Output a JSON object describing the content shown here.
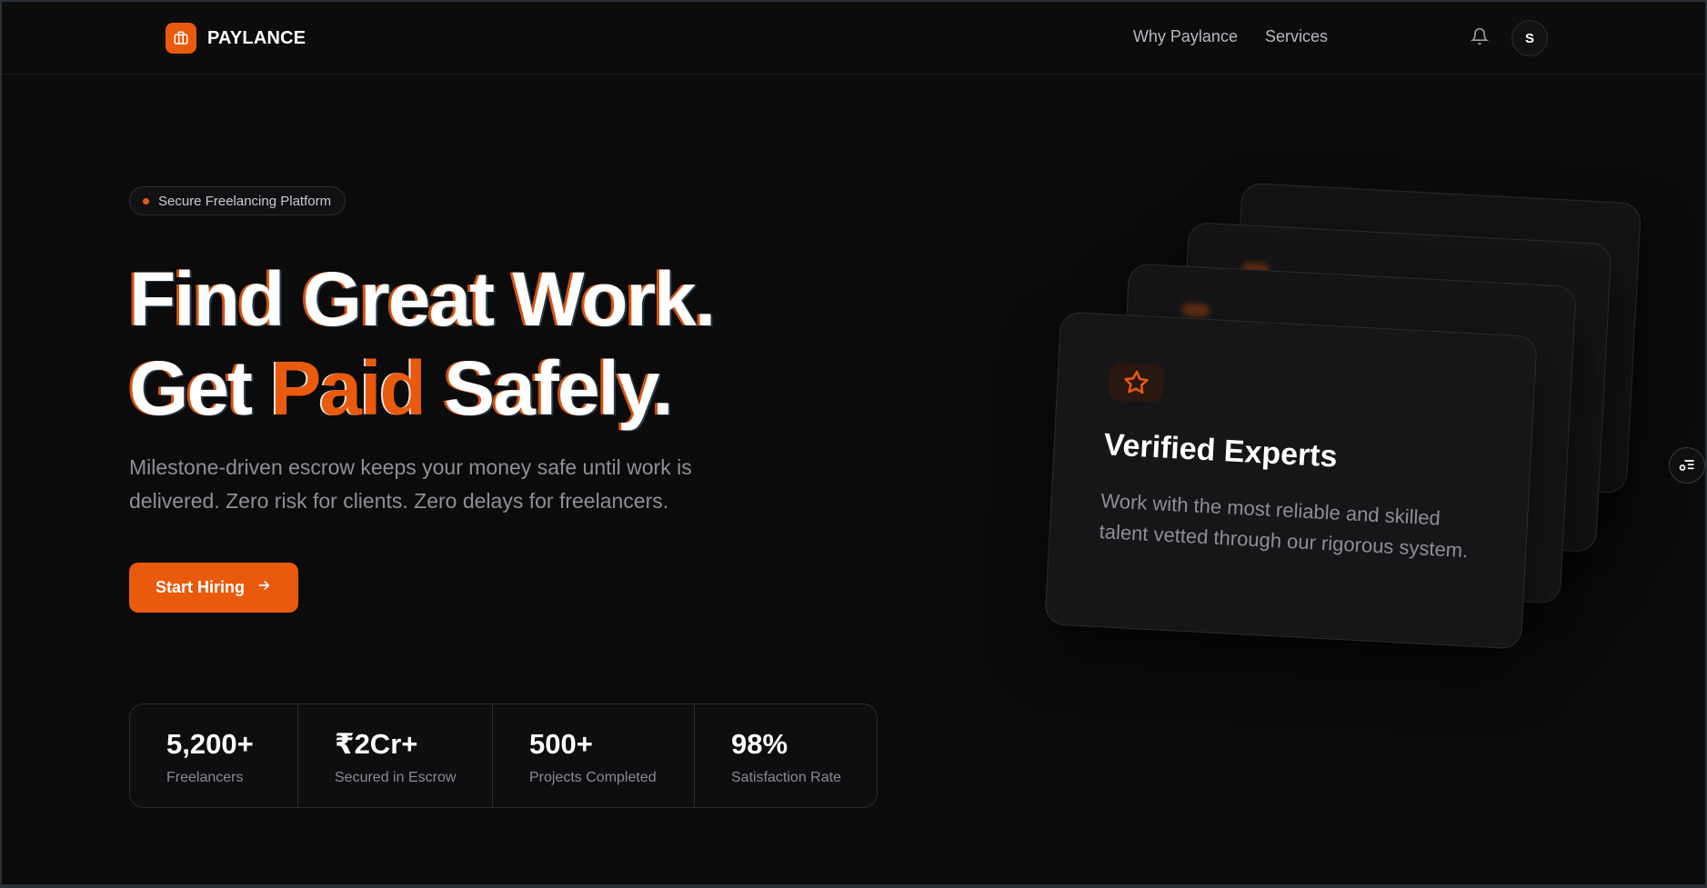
{
  "brand": {
    "name": "PAYLANCE",
    "logo_icon": "briefcase-icon",
    "accent": "#ea5a0c"
  },
  "nav": {
    "items": [
      "Why Paylance",
      "Services"
    ]
  },
  "header": {
    "bell_icon": "bell-icon",
    "avatar_initial": "S"
  },
  "hero": {
    "pill": "Secure Freelancing Platform",
    "headline": {
      "line1": "Find Great Work.",
      "line2_start": "Get ",
      "line2_accent": "Paid",
      "line2_end": " Safely."
    },
    "subtext": "Milestone-driven escrow keeps your money safe until work is delivered. Zero risk for clients. Zero delays for freelancers.",
    "cta": "Start Hiring",
    "cta_icon": "arrow-right-icon"
  },
  "stats": [
    {
      "value": "5,200+",
      "label": "Freelancers"
    },
    {
      "value": "₹2Cr+",
      "label": "Secured in Escrow"
    },
    {
      "value": "500+",
      "label": "Projects Completed"
    },
    {
      "value": "98%",
      "label": "Satisfaction Rate"
    }
  ],
  "feature_card": {
    "icon": "star-icon",
    "title": "Verified Experts",
    "description": "Work with the most reliable and skilled talent vetted through our rigorous system."
  },
  "side_tab_icon": "filter-list-icon"
}
